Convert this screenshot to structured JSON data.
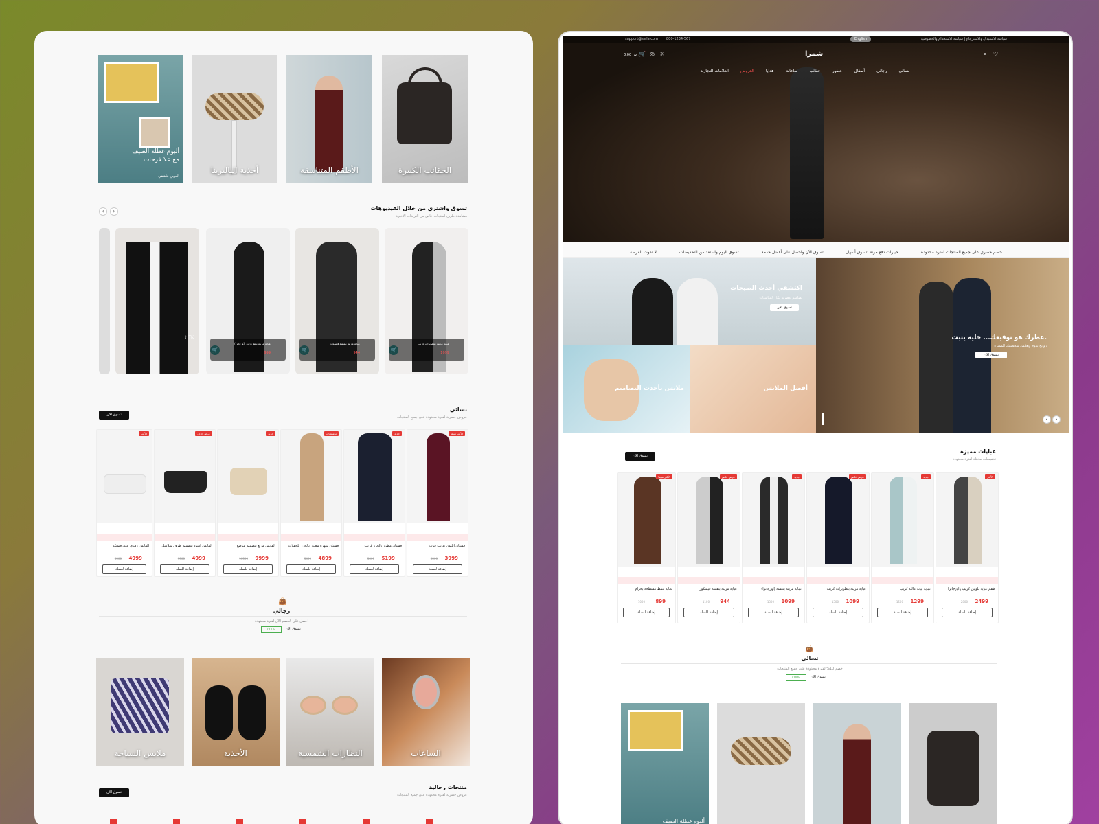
{
  "left": {
    "top_categories": [
      {
        "label": "الحقائب الكبيرة"
      },
      {
        "label": "الأطقم المتناسقة"
      },
      {
        "label": "أحذية الباليرينا"
      },
      {
        "label": "ألبوم غطلة الصيف",
        "label2": "مع علا فرحات",
        "byline": "العربي عاشقي"
      }
    ],
    "videos": {
      "title": "تسوق واشتري من خلال الفيديوهات",
      "subtitle": "مشاهدة طرف لمنتجات خاص من الترندات الأخيرة",
      "items": [
        {
          "name": "عباية مزينة بتطريزات كريب",
          "price": "1099"
        },
        {
          "name": "عباية مزينة بنقشة فيسكوز",
          "price": "944"
        },
        {
          "name": "عباية مزينة بتطريزات (أورجانزا)",
          "price": "999"
        }
      ]
    },
    "women": {
      "title": "نسائي",
      "subtitle": "عروض حصرية لفترة محدودة على جميع المنتجات",
      "shop_btn": "تسوق الان",
      "products": [
        {
          "name": "فستان ابليون بذانب قرب",
          "price": "3999",
          "old": "4500",
          "badge": "الأكثر مبيعا"
        },
        {
          "name": "فستان مطرز بالخرز كريب",
          "price": "5199",
          "old": "5800",
          "badge": "جديد"
        },
        {
          "name": "فستان سهرة مطرز بالخرز للحفلات",
          "price": "4899",
          "old": "5400",
          "badge": "تخفيضات"
        },
        {
          "name": "الفاتش مربع بتصميم مرصع",
          "price": "9999",
          "old": "10500",
          "badge": "جديد"
        },
        {
          "name": "الفاتش أسود بتصميم طرف سلاسل",
          "price": "4999",
          "old": "5500",
          "badge": "عرض خاص"
        },
        {
          "name": "الفاتش زهري على فيونكة",
          "price": "4999",
          "old": "5500",
          "badge": "الأكثر"
        }
      ],
      "add_label": "إضافة للسلة"
    },
    "men_promo": {
      "title": "رجالي",
      "subtitle": "احصل على الخصم الآن لفترة محدودة",
      "code": "CODE",
      "shop": "تسوق الان"
    },
    "men_categories": [
      {
        "label": "الساعات"
      },
      {
        "label": "النظارات الشمسية"
      },
      {
        "label": "الأحذية"
      },
      {
        "label": "ملابس السباحة"
      }
    ],
    "men_products": {
      "title": "منتجات رجالية",
      "subtitle": "عروض حصرية لفترة محدودة على جميع المنتجات",
      "shop_btn": "تسوق الان"
    }
  },
  "right": {
    "topbar": {
      "email": "support@salla.com",
      "phone": "800-1234-567",
      "links": "سياسة الاستبدال والاسترجاع | سياسة الاستخدام والخصوصية",
      "lang": "English"
    },
    "logo": "شمرا",
    "cart_total": "0.00 ر.س",
    "nav": [
      "نسائي",
      "رجالي",
      "أطفال",
      "عطور",
      "حقائب",
      "ساعات",
      "هدايا",
      "العروض",
      "العلامات التجارية"
    ],
    "features": [
      "خصم حصري على جميع المنتجات لفترة محدودة",
      "خيارات دفع مرنة لتسوق أسهل",
      "تسوق الآن واحصل على أفضل خدمة",
      "تسوق اليوم واستفد من التخفيضات",
      "لا تفوت الفرصة"
    ],
    "banners": {
      "b1_title": "اكتشفي أحدث الصيحات",
      "b1_sub": "تصاميم عصرية لكل المناسبات",
      "b1_btn": "تسوق الان",
      "b2_title": "عطرك هو توقيعك... خليه يثبت.",
      "b2_sub": "روائح تدوم وتعكس شخصيتك المميزة",
      "b2_btn": "تسوق الان",
      "b3_title": "ملابس بأحدث التصاميم",
      "b4_title": "أفضل الملابس"
    },
    "abayas": {
      "title": "عبايات مميزة",
      "subtitle": "تخفيضات مذهلة لفترة محدودة",
      "shop_btn": "تسوق الان",
      "add_label": "إضافة للسلة",
      "products": [
        {
          "name": "طقم عباية بلونين كريب وأورجانزا",
          "price": "2499",
          "old": "2800",
          "badge": "الأكثر"
        },
        {
          "name": "عباية بيانة عالية كريب",
          "price": "1299",
          "old": "1500",
          "badge": "جديد"
        },
        {
          "name": "عباية مزينة بتطريزات كريب",
          "price": "1099",
          "old": "1300",
          "badge": "عرض خاص"
        },
        {
          "name": "عباية مزينة بنقشة (أورجانزا)",
          "price": "1099",
          "old": "1300",
          "badge": "جديد"
        },
        {
          "name": "عباية مزينة بنقشة فيسكوز",
          "price": "944",
          "old": "1100",
          "badge": "عرض خاص"
        },
        {
          "name": "عباية بنمط مسطحة بحزام",
          "price": "899",
          "old": "1000",
          "badge": "الأكثر مبيعا"
        }
      ]
    },
    "women_promo": {
      "title": "نسائي",
      "subtitle": "خصم 10% لفترة محدودة على جميع المنتجات",
      "code": "CODE",
      "shop": "تسوق الان"
    },
    "bottom_category": "ألبوم غطلة الصيف"
  }
}
